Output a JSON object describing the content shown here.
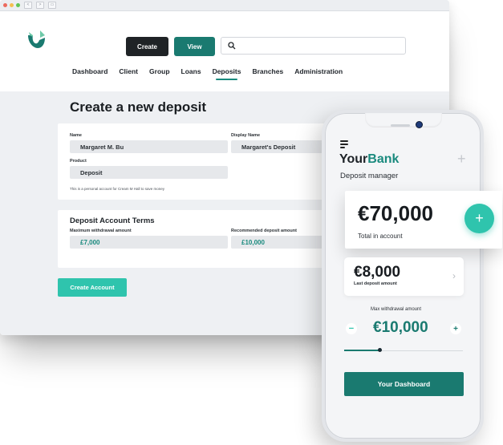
{
  "browser": {
    "nav_back": "<",
    "nav_forward": ">",
    "tab_icon": "window-icon"
  },
  "header": {
    "logo_icon": "leaf-check-logo",
    "create_label": "Create",
    "view_label": "View",
    "search_icon": "search-icon",
    "search_placeholder": ""
  },
  "menu": {
    "items": [
      "Dashboard",
      "Client",
      "Group",
      "Loans",
      "Deposits",
      "Branches",
      "Administration"
    ],
    "active_index": 4
  },
  "page": {
    "title": "Create a new deposit"
  },
  "form": {
    "name_label": "Name",
    "name_value": "Margaret M. Bu",
    "display_name_label": "Display Name",
    "display_name_value": "Margaret's Deposit",
    "product_label": "Product",
    "product_value": "Deposit",
    "note": "This is a personal account for Cream M Hall to save money"
  },
  "terms": {
    "title": "Deposit Account Terms",
    "max_withdrawal_label": "Maximum withdrawal amount",
    "max_withdrawal_value": "£7,000",
    "recommended_label": "Recommended deposit amount",
    "recommended_value": "£10,000"
  },
  "create_account_label": "Create Account",
  "phone": {
    "menu_icon": "hamburger-icon",
    "brand_your": "Your",
    "brand_bank": "Bank",
    "plus_icon": "+",
    "subtitle": "Deposit manager",
    "total_amount": "€70,000",
    "total_label": "Total in account",
    "fab_label": "+",
    "last_deposit_amount": "€8,000",
    "last_deposit_label": "Last deposit amount",
    "chevron_icon": "›",
    "max_withdrawal_label": "Max withdrawal amount",
    "minus_label": "−",
    "max_withdrawal_amount": "€10,000",
    "plus_label": "+",
    "slider_level": 0.3,
    "dashboard_button": "Your Dashboard"
  },
  "colors": {
    "teal": "#1a7a70",
    "mint": "#2fc4ad",
    "dark": "#1f2326"
  }
}
